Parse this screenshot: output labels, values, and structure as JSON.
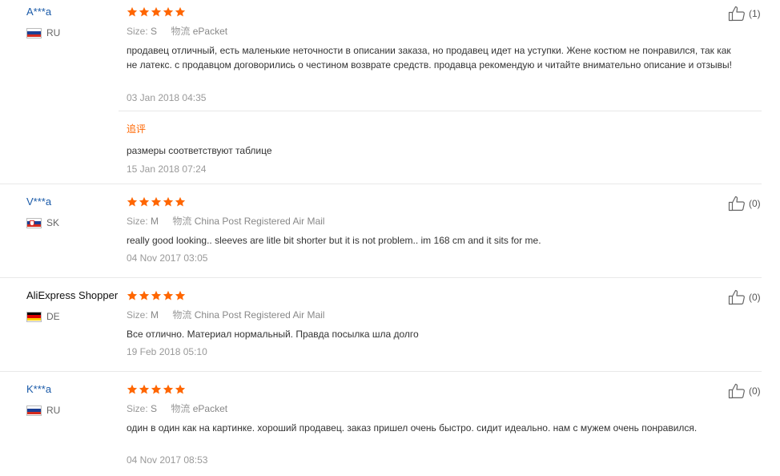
{
  "reviews": [
    {
      "user": "A***a",
      "country": "RU",
      "size_label": "Size:",
      "size_value": "S",
      "shipping_label": "物流",
      "shipping_value": "ePacket",
      "text": "продавец отличный, есть маленькие неточности в описании заказа, но продавец идет на уступки. Жене костюм не понравился, так как не латекс. с продавцом договорились о честином возврате средств. продавца рекомендую и читайте внимательно описание и отзывы!",
      "date": "03 Jan 2018 04:35",
      "likes": "(1)",
      "rating": 5,
      "additional": {
        "label": "追评",
        "text": "размеры соответствуют таблице",
        "date": "15 Jan 2018 07:24"
      }
    },
    {
      "user": "V***a",
      "country": "SK",
      "size_label": "Size:",
      "size_value": "M",
      "shipping_label": "物流",
      "shipping_value": "China Post Registered Air Mail",
      "text": "really good looking.. sleeves are litle bit shorter but it is not problem.. im 168 cm and it sits for me.",
      "date": "04 Nov 2017 03:05",
      "likes": "(0)",
      "rating": 5
    },
    {
      "user": "AliExpress Shopper",
      "country": "DE",
      "size_label": "Size:",
      "size_value": "M",
      "shipping_label": "物流",
      "shipping_value": "China Post Registered Air Mail",
      "text": "Все отлично. Материал нормальный. Правда посылка шла долго",
      "date": "19 Feb 2018 05:10",
      "likes": "(0)",
      "rating": 5
    },
    {
      "user": "K***a",
      "country": "RU",
      "size_label": "Size:",
      "size_value": "S",
      "shipping_label": "物流",
      "shipping_value": "ePacket",
      "text": "один в один как на картинке. хороший продавец. заказ пришел очень быстро. сидит идеально. нам с мужем очень понравился.",
      "date": "04 Nov 2017 08:53",
      "likes": "(0)",
      "rating": 5
    }
  ],
  "colors": {
    "star": "#f60",
    "link": "#1a5aa8",
    "additional_label": "#f60"
  },
  "icons": {
    "star": "star-icon",
    "like": "thumbs-up-icon"
  }
}
